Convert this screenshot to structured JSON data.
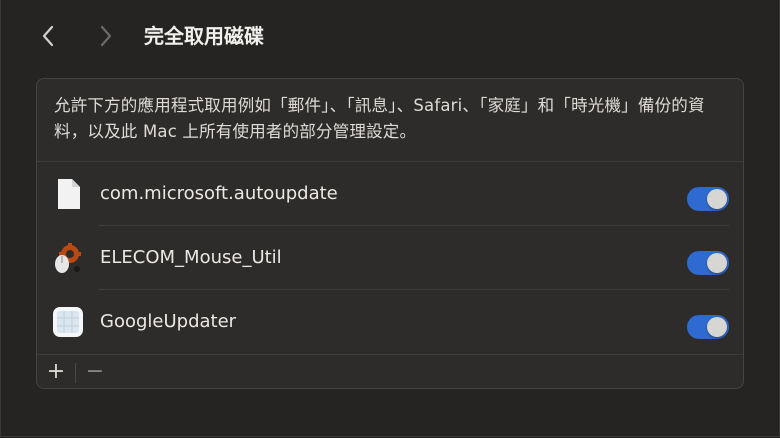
{
  "header": {
    "title": "完全取用磁碟",
    "back_icon": "chevron-left-icon",
    "forward_icon": "chevron-right-icon"
  },
  "panel": {
    "description": "允許下方的應用程式取用例如「郵件」、「訊息」、Safari、「家庭」和「時光機」備份的資料，以及此 Mac 上所有使用者的部分管理設定。"
  },
  "apps": [
    {
      "name": "com.microsoft.autoupdate",
      "icon": "document-icon",
      "enabled": true
    },
    {
      "name": "ELECOM_Mouse_Util",
      "icon": "elecom-mouse-icon",
      "enabled": true
    },
    {
      "name": "GoogleUpdater",
      "icon": "google-updater-icon",
      "enabled": true
    }
  ],
  "footer": {
    "add_label": "+",
    "remove_label": "−"
  },
  "colors": {
    "background": "#262422",
    "panel": "#2e2c2a",
    "toggle_on": "#2f6ad1"
  }
}
